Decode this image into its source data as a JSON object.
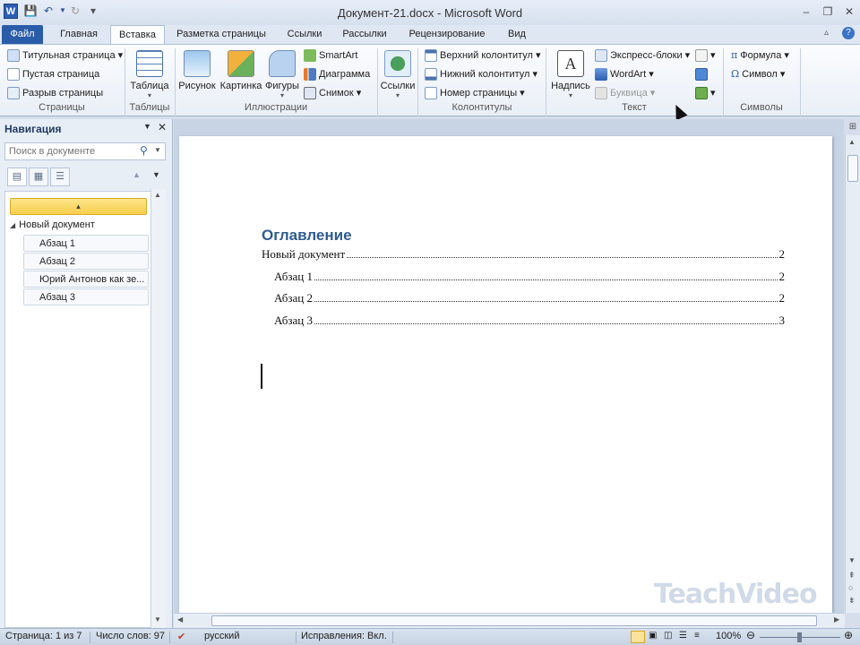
{
  "window": {
    "title": "Документ-21.docx - Microsoft Word",
    "app_icon": "W"
  },
  "quick_access": [
    "save-icon",
    "undo-icon",
    "redo-icon",
    "customize-icon"
  ],
  "tabs": [
    {
      "label": "Файл"
    },
    {
      "label": "Главная"
    },
    {
      "label": "Вставка"
    },
    {
      "label": "Разметка страницы"
    },
    {
      "label": "Ссылки"
    },
    {
      "label": "Рассылки"
    },
    {
      "label": "Рецензирование"
    },
    {
      "label": "Вид"
    }
  ],
  "active_tab": "Вставка",
  "ribbon": {
    "pages": {
      "label": "Страницы",
      "items": [
        "Титульная страница",
        "Пустая страница",
        "Разрыв страницы"
      ]
    },
    "tables": {
      "label": "Таблицы",
      "button": "Таблица"
    },
    "illustrations": {
      "label": "Иллюстрации",
      "buttons": [
        "Рисунок",
        "Картинка",
        "Фигуры"
      ],
      "small": [
        "SmartArt",
        "Диаграмма",
        "Снимок"
      ]
    },
    "links": {
      "button": "Ссылки"
    },
    "header_footer": {
      "label": "Колонтитулы",
      "items": [
        "Верхний колонтитул",
        "Нижний колонтитул",
        "Номер страницы"
      ]
    },
    "text": {
      "label": "Текст",
      "button": "Надпись",
      "items": [
        "Экспресс-блоки",
        "WordArt",
        "Буквица"
      ]
    },
    "symbols": {
      "label": "Символы",
      "items": [
        "Формула",
        "Символ"
      ]
    }
  },
  "nav": {
    "title": "Навигация",
    "search_placeholder": "Поиск в документе",
    "root": "Новый документ",
    "items": [
      "Абзац 1",
      "Абзац 2",
      "Юрий Антонов как зе...",
      "Абзац 3"
    ]
  },
  "document": {
    "toc_heading": "Оглавление",
    "toc": [
      {
        "text": "Новый документ",
        "page": "2"
      },
      {
        "text": "Абзац 1",
        "page": "2"
      },
      {
        "text": "Абзац 2",
        "page": "2"
      },
      {
        "text": "Абзац 3",
        "page": "3"
      }
    ]
  },
  "status": {
    "page": "Страница: 1 из 7",
    "words": "Число слов: 97",
    "language": "русский",
    "track": "Исправления: Вкл.",
    "zoom": "100%"
  },
  "watermark": "TeachVideo"
}
